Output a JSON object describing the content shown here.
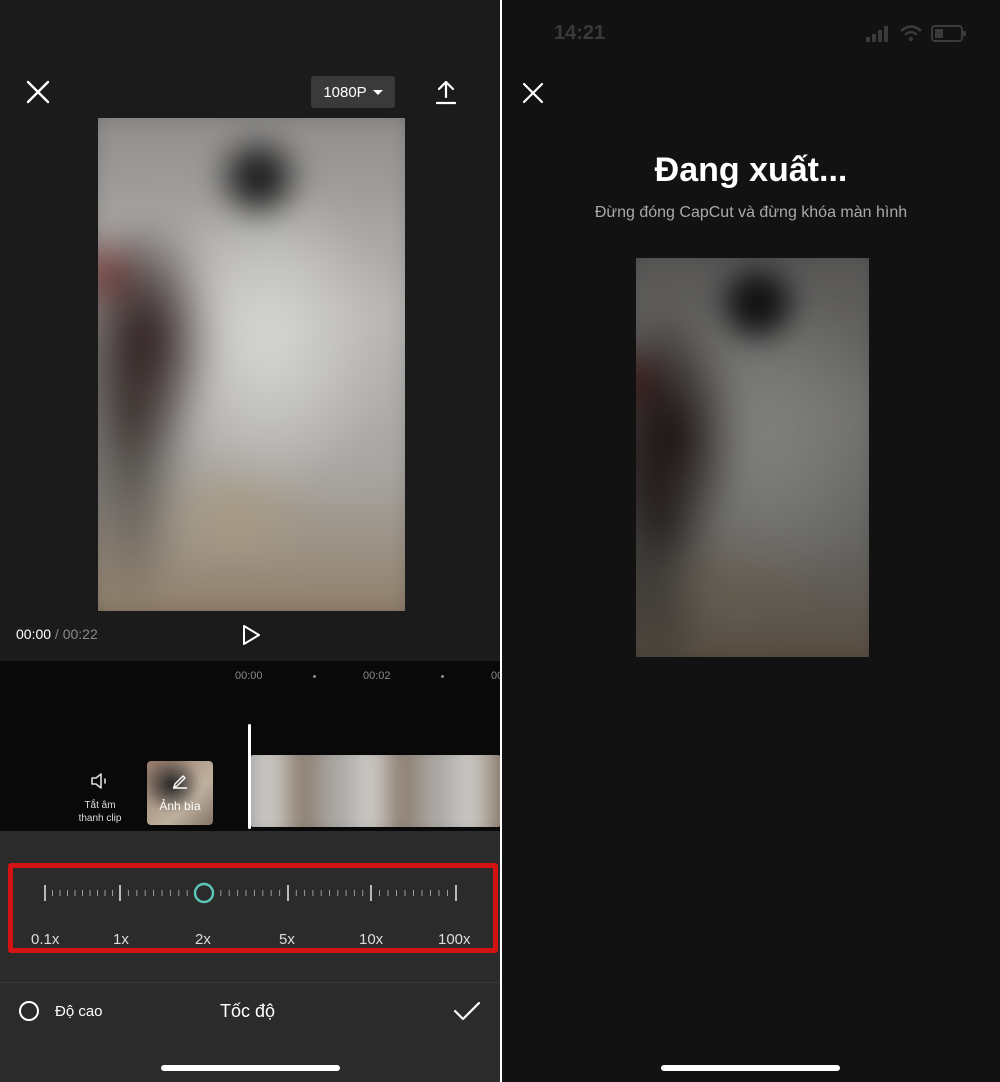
{
  "left_screen": {
    "resolution_label": "1080P",
    "time_current": "00:00",
    "time_separator": " / ",
    "time_total": "00:22",
    "timeline_ticks": [
      "00:00",
      "00:02",
      "00"
    ],
    "mute_label_line1": "Tắt âm",
    "mute_label_line2": "thanh clip",
    "cover_label": "Ảnh bìa",
    "speed_scale": [
      "0.1x",
      "1x",
      "2x",
      "5x",
      "10x",
      "100x"
    ],
    "speed_value": "2x",
    "height_label": "Độ cao",
    "bottom_title": "Tốc độ",
    "highlight_color": "#d41414",
    "slider_knob_color": "#5ec8b8"
  },
  "right_screen": {
    "status_time": "14:21",
    "export_title": "Đang xuất...",
    "export_subtitle": "Đừng đóng CapCut và đừng khóa màn hình"
  }
}
